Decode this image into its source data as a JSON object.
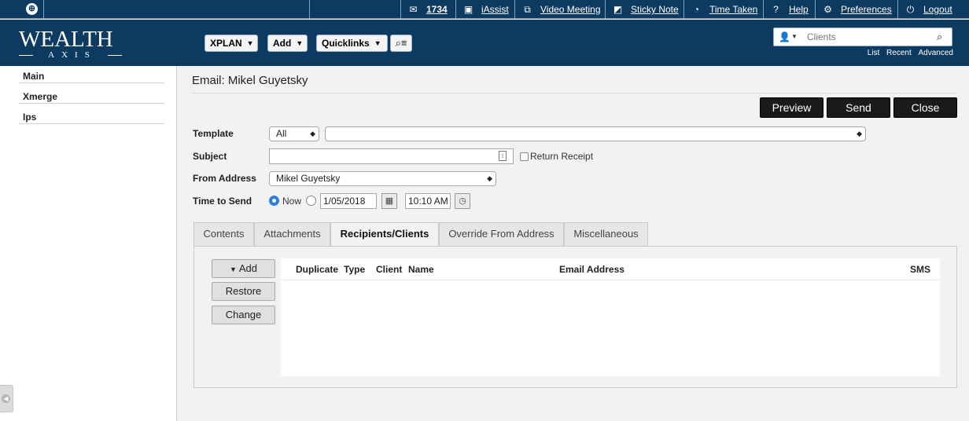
{
  "topbar": {
    "mail_count": "1734",
    "iassist": "iAssist",
    "video_meeting": "Video Meeting",
    "sticky_note": "Sticky Note",
    "time_taken": "Time Taken",
    "help": "Help",
    "preferences": "Preferences",
    "logout": "Logout"
  },
  "header": {
    "logo_top": "WEALTH",
    "logo_bottom": "AXIS",
    "nav": [
      "XPLAN",
      "Add",
      "Quicklinks"
    ],
    "client_search_placeholder": "Clients",
    "client_links": [
      "List",
      "Recent",
      "Advanced"
    ]
  },
  "sidebar": {
    "items": [
      "Main",
      "Xmerge",
      "Ips"
    ]
  },
  "page": {
    "title": "Email: Mikel Guyetsky",
    "actions": [
      "Preview",
      "Send",
      "Close"
    ]
  },
  "form": {
    "template_label": "Template",
    "template_filter": "All",
    "template_value": "",
    "subject_label": "Subject",
    "subject_value": "",
    "return_receipt_label": "Return Receipt",
    "from_label": "From Address",
    "from_value": "Mikel Guyetsky",
    "time_label": "Time to Send",
    "now_label": "Now",
    "date_value": "1/05/2018",
    "time_value": "10:10 AM"
  },
  "tabs": [
    {
      "label": "Contents",
      "active": false
    },
    {
      "label": "Attachments",
      "active": false
    },
    {
      "label": "Recipients/Clients",
      "active": true
    },
    {
      "label": "Override From Address",
      "active": false
    },
    {
      "label": "Miscellaneous",
      "active": false
    }
  ],
  "recipients": {
    "buttons": [
      "Add",
      "Restore",
      "Change"
    ],
    "columns": [
      "Duplicate",
      "Type",
      "Client",
      "Name",
      "Email Address",
      "SMS"
    ],
    "rows": []
  }
}
